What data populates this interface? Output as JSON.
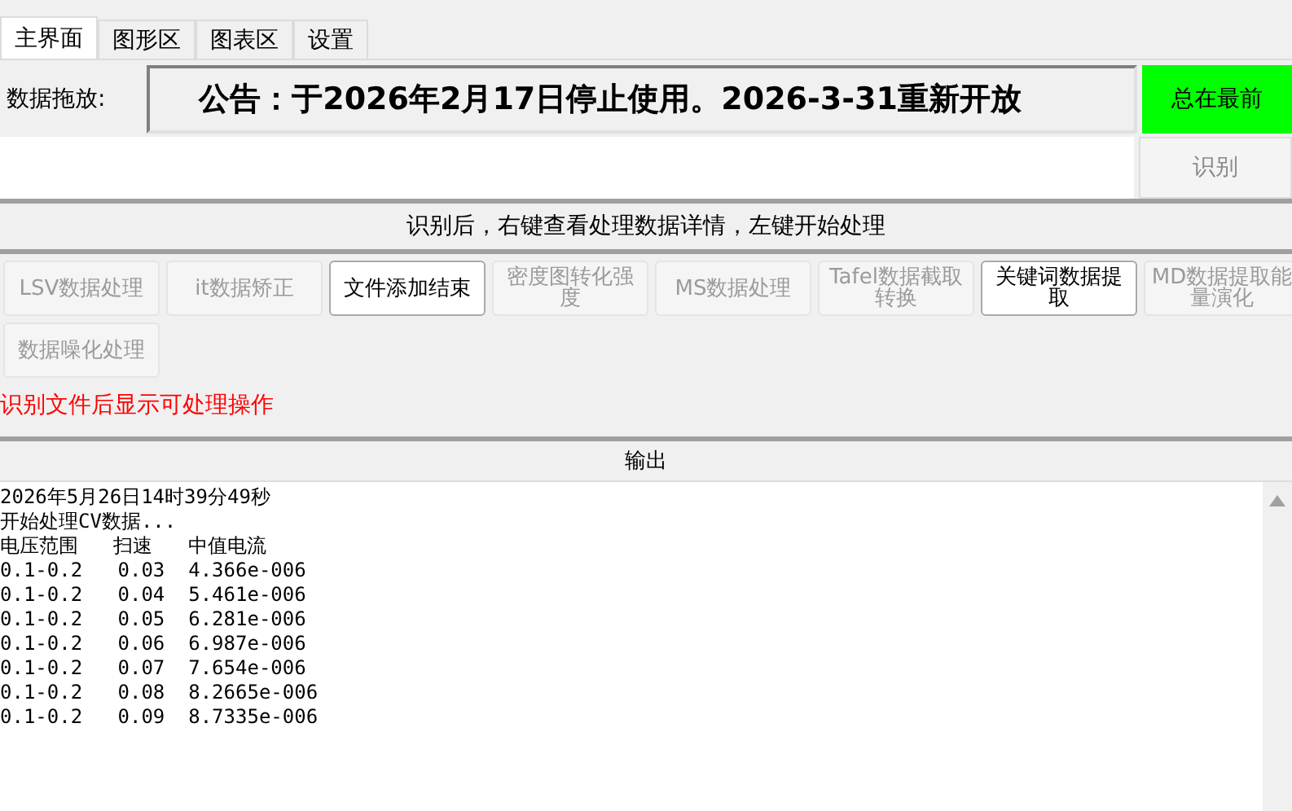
{
  "tabs": [
    {
      "label": "主界面",
      "selected": true
    },
    {
      "label": "图形区",
      "selected": false
    },
    {
      "label": "图表区",
      "selected": false
    },
    {
      "label": "设置",
      "selected": false
    }
  ],
  "drop_label": "数据拖放:",
  "announcement": "公告：于2026年2月17日停止使用。2026-3-31重新开放",
  "pin_button": {
    "label": "总在最前",
    "on": true
  },
  "recognize_button": {
    "label": "识别",
    "disabled": true
  },
  "hint": "识别后，右键查看处理数据详情，左键开始处理",
  "actions": [
    {
      "label": "LSV数据处理",
      "disabled": true
    },
    {
      "label": "it数据矫正",
      "disabled": true
    },
    {
      "label": "文件添加结束",
      "disabled": false
    },
    {
      "label": "密度图转化强度",
      "disabled": true
    },
    {
      "label": "MS数据处理",
      "disabled": true
    },
    {
      "label": "Tafel数据截取转换",
      "disabled": true
    },
    {
      "label": "关键词数据提取",
      "disabled": false
    },
    {
      "label": "MD数据提取能量演化",
      "disabled": true
    },
    {
      "label": "数据噪化处理",
      "disabled": true
    }
  ],
  "notice": "识别文件后显示可处理操作",
  "output": {
    "title": "输出",
    "lines": [
      "2026年5月26日14时39分49秒",
      "开始处理CV数据...",
      "电压范围   扫速   中值电流",
      "0.1-0.2   0.03  4.366e-006",
      "0.1-0.2   0.04  5.461e-006",
      "0.1-0.2   0.05  6.281e-006",
      "0.1-0.2   0.06  6.987e-006",
      "0.1-0.2   0.07  7.654e-006",
      "0.1-0.2   0.08  8.2665e-006",
      "0.1-0.2   0.09  8.7335e-006"
    ]
  }
}
